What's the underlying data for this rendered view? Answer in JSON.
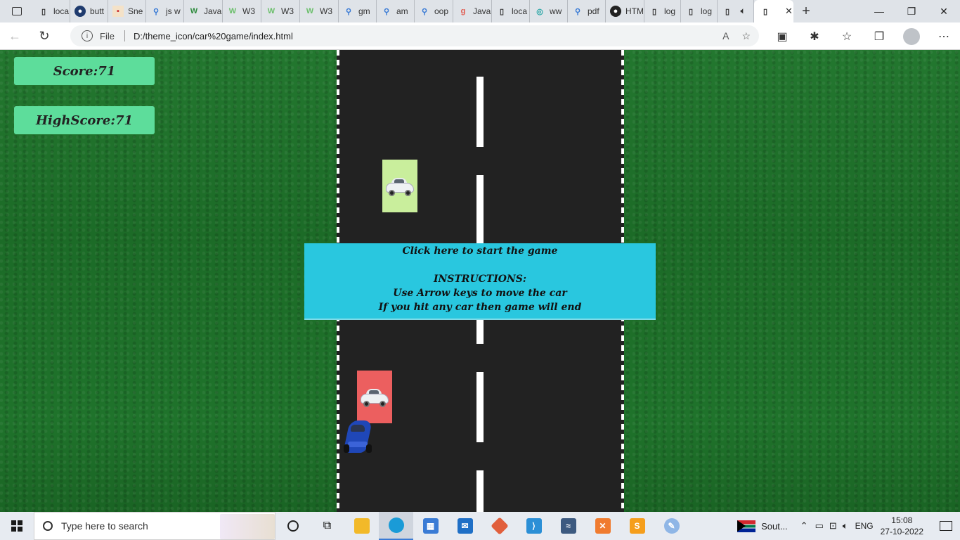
{
  "browser": {
    "tabs": [
      {
        "label": "loca",
        "icon": "page-icon"
      },
      {
        "label": "butt",
        "icon": "profile-icon"
      },
      {
        "label": "Sne",
        "icon": "snippet-icon"
      },
      {
        "label": "js w",
        "icon": "search-icon"
      },
      {
        "label": "Java",
        "icon": "w3-icon"
      },
      {
        "label": "W3",
        "icon": "w3-icon"
      },
      {
        "label": "W3",
        "icon": "w3-icon"
      },
      {
        "label": "W3",
        "icon": "w3-icon"
      },
      {
        "label": "gm",
        "icon": "search-icon"
      },
      {
        "label": "am",
        "icon": "search-icon"
      },
      {
        "label": "oop",
        "icon": "search-icon"
      },
      {
        "label": "Java",
        "icon": "gfg-icon"
      },
      {
        "label": "loca",
        "icon": "page-icon"
      },
      {
        "label": "ww",
        "icon": "edge-icon"
      },
      {
        "label": "pdf",
        "icon": "search-icon"
      },
      {
        "label": "HTM",
        "icon": "github-icon"
      },
      {
        "label": "log",
        "icon": "page-icon"
      },
      {
        "label": "log",
        "icon": "page-icon"
      }
    ],
    "active_tab_label": "",
    "file_label": "File",
    "url": "D:/theme_icon/car%20game/index.html"
  },
  "game": {
    "score_label": "Score:71",
    "highscore_label": "HighScore:71",
    "start_text": "Click here to start the game",
    "instructions_title": "INSTRUCTIONS:",
    "instruction_1": "Use Arrow keys to move the car",
    "instruction_2": "If you hit any car then game will end",
    "enemy_colors": [
      "#c9ee9c",
      "#ec5f5f"
    ],
    "road_color": "#222222",
    "panel_color": "#29c7df",
    "score_box_color": "#5ddd9b"
  },
  "taskbar": {
    "search_placeholder": "Type here to search",
    "weather_label": "Sout...",
    "language": "ENG",
    "time": "15:08",
    "date": "27-10-2022"
  }
}
